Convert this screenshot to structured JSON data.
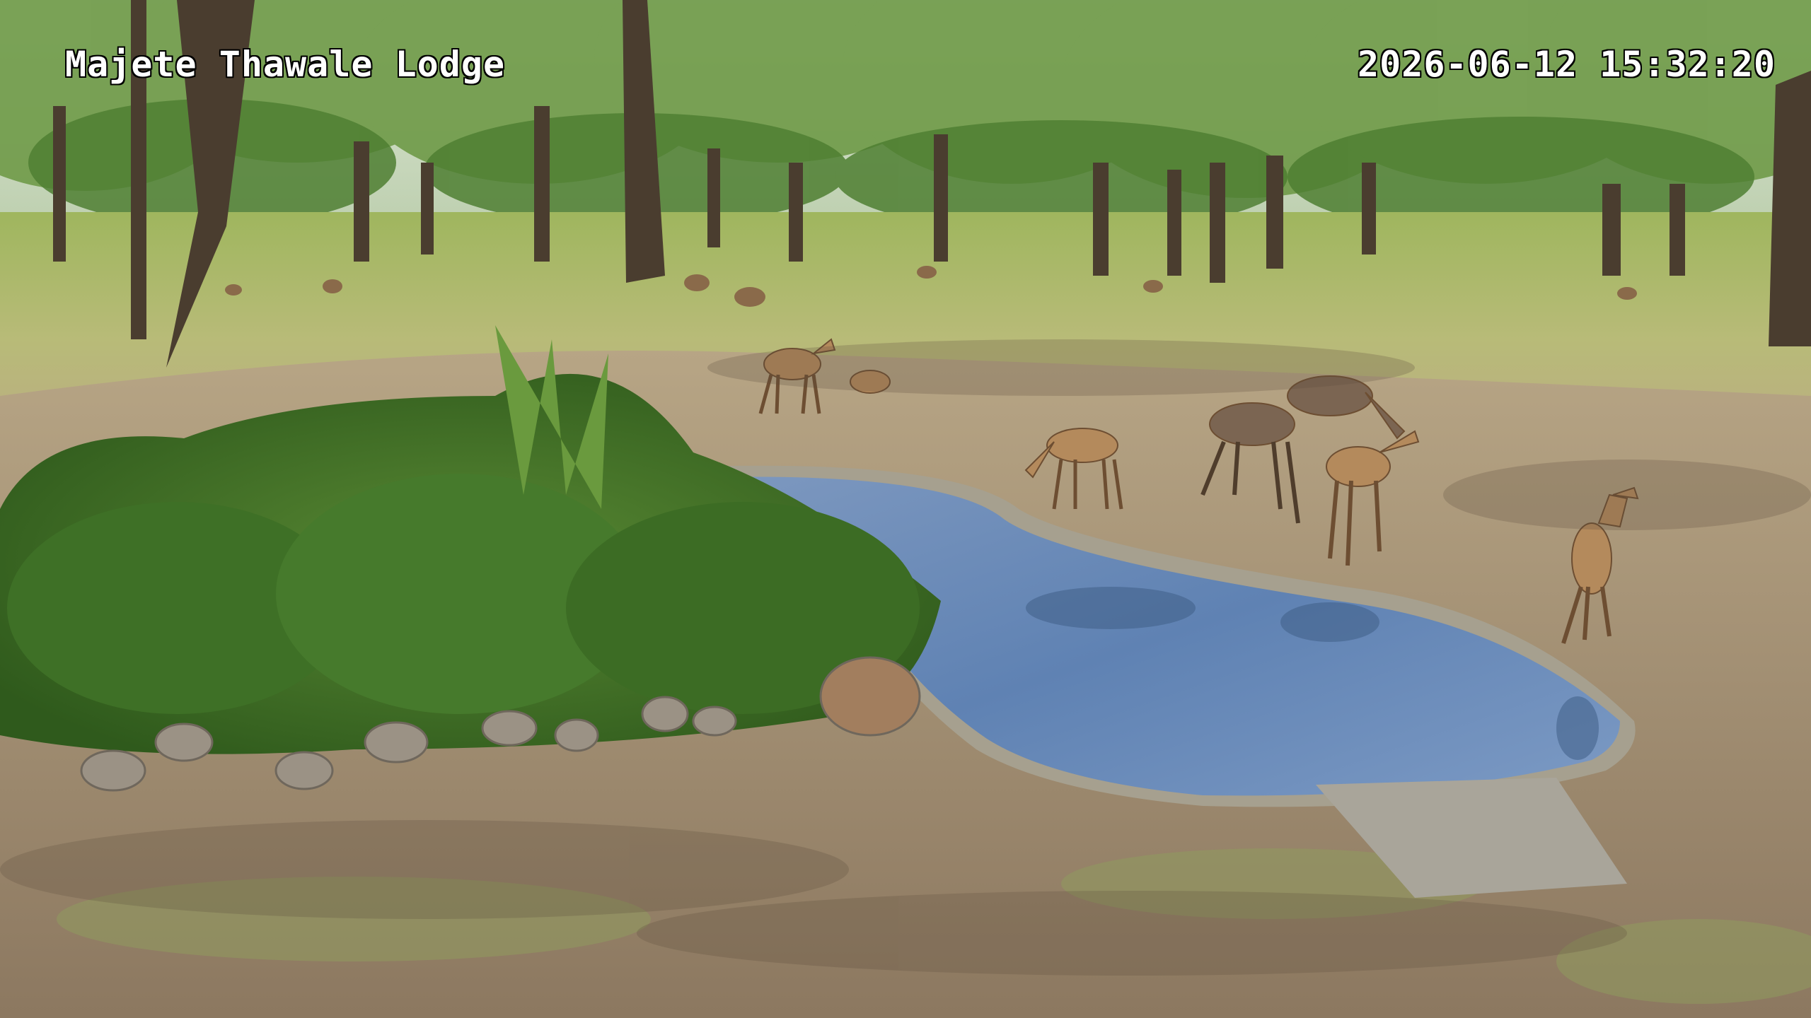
{
  "overlay": {
    "location": "Majete Thawale Lodge",
    "timestamp": "2026-06-12 15:32:20"
  },
  "colors": {
    "sky": "#e8efe2",
    "grass": "#a9b76a",
    "dirt": "#b6a283",
    "water": "#6f8fb8",
    "foliage": "#4f7d2c",
    "antelope": "#b48a5c"
  }
}
